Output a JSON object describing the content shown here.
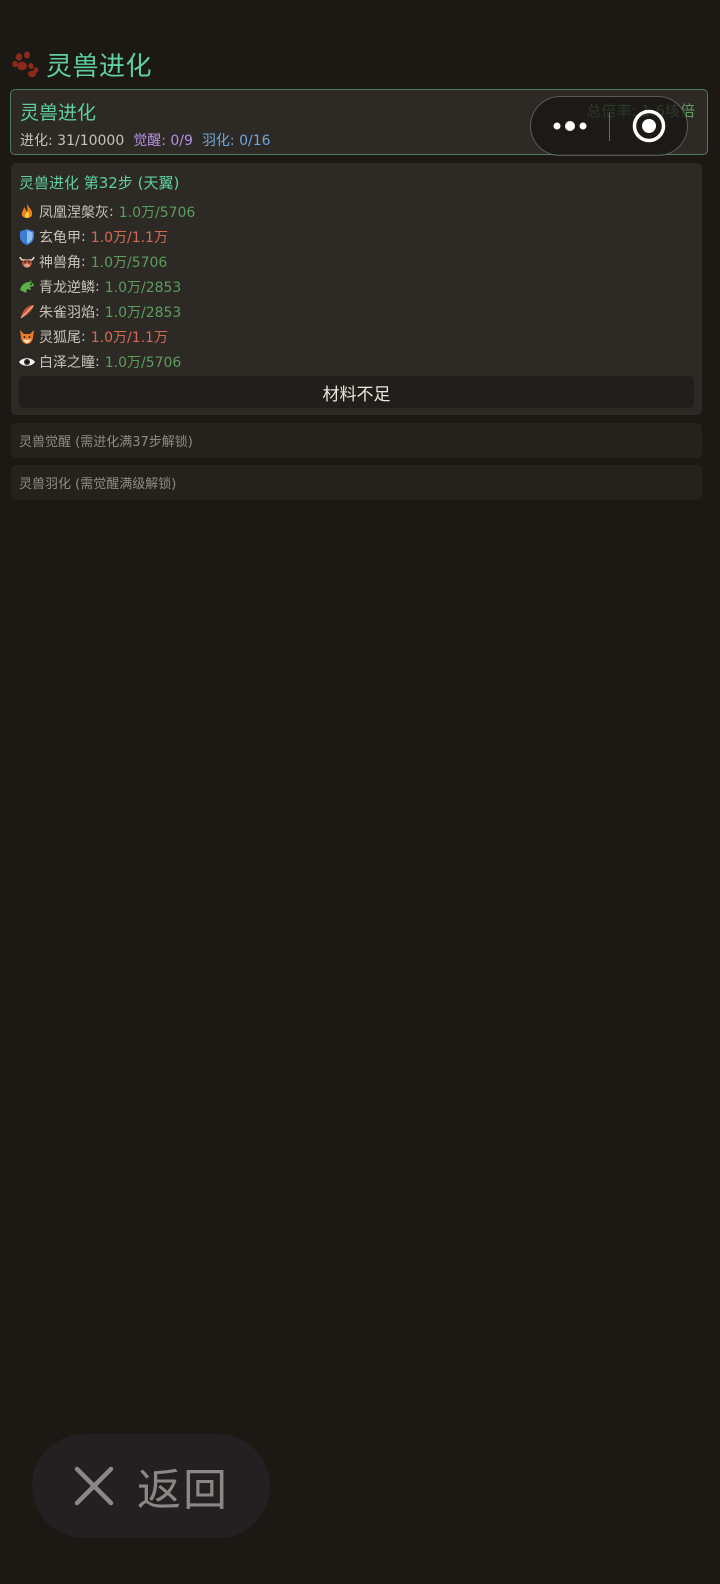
{
  "header": {
    "title": "灵兽进化",
    "icon": "paw-icon"
  },
  "summary": {
    "title": "灵兽进化",
    "evolve": "进化: 31/10000",
    "awaken": "觉醒: 0/9",
    "feather": "羽化: 0/16",
    "total_rate": "总倍率: 1.6垓倍"
  },
  "capsule": {
    "more_icon": "more-dots-icon",
    "close_icon": "target-close-icon"
  },
  "step": {
    "title": "灵兽进化 第32步 (天翼)",
    "materials": [
      {
        "icon": "fire-icon",
        "name": "凤凰涅槃灰",
        "value": "1.0万/5706",
        "status": "ok"
      },
      {
        "icon": "shield-icon",
        "name": "玄龟甲",
        "value": "1.0万/1.1万",
        "status": "short"
      },
      {
        "icon": "ox-icon",
        "name": "神兽角",
        "value": "1.0万/5706",
        "status": "ok"
      },
      {
        "icon": "dragon-icon",
        "name": "青龙逆鳞",
        "value": "1.0万/2853",
        "status": "ok"
      },
      {
        "icon": "feather-icon",
        "name": "朱雀羽焰",
        "value": "1.0万/2853",
        "status": "ok"
      },
      {
        "icon": "fox-icon",
        "name": "灵狐尾",
        "value": "1.0万/1.1万",
        "status": "short"
      },
      {
        "icon": "eye-icon",
        "name": "白泽之瞳",
        "value": "1.0万/5706",
        "status": "ok"
      }
    ],
    "button_label": "材料不足"
  },
  "locked": {
    "awaken": "灵兽觉醒 (需进化满37步解锁)",
    "feather": "灵兽羽化 (需觉醒满级解锁)"
  },
  "back": {
    "label": "返回",
    "icon": "close-x-icon"
  },
  "colors": {
    "accent_green": "#5fcf9f",
    "ok_green": "#5d9c5e",
    "short_red": "#d46a55",
    "awaken_purple": "#b38fe0",
    "feather_blue": "#6fa4d9",
    "background": "#1c1915",
    "card": "#2d2a26"
  }
}
